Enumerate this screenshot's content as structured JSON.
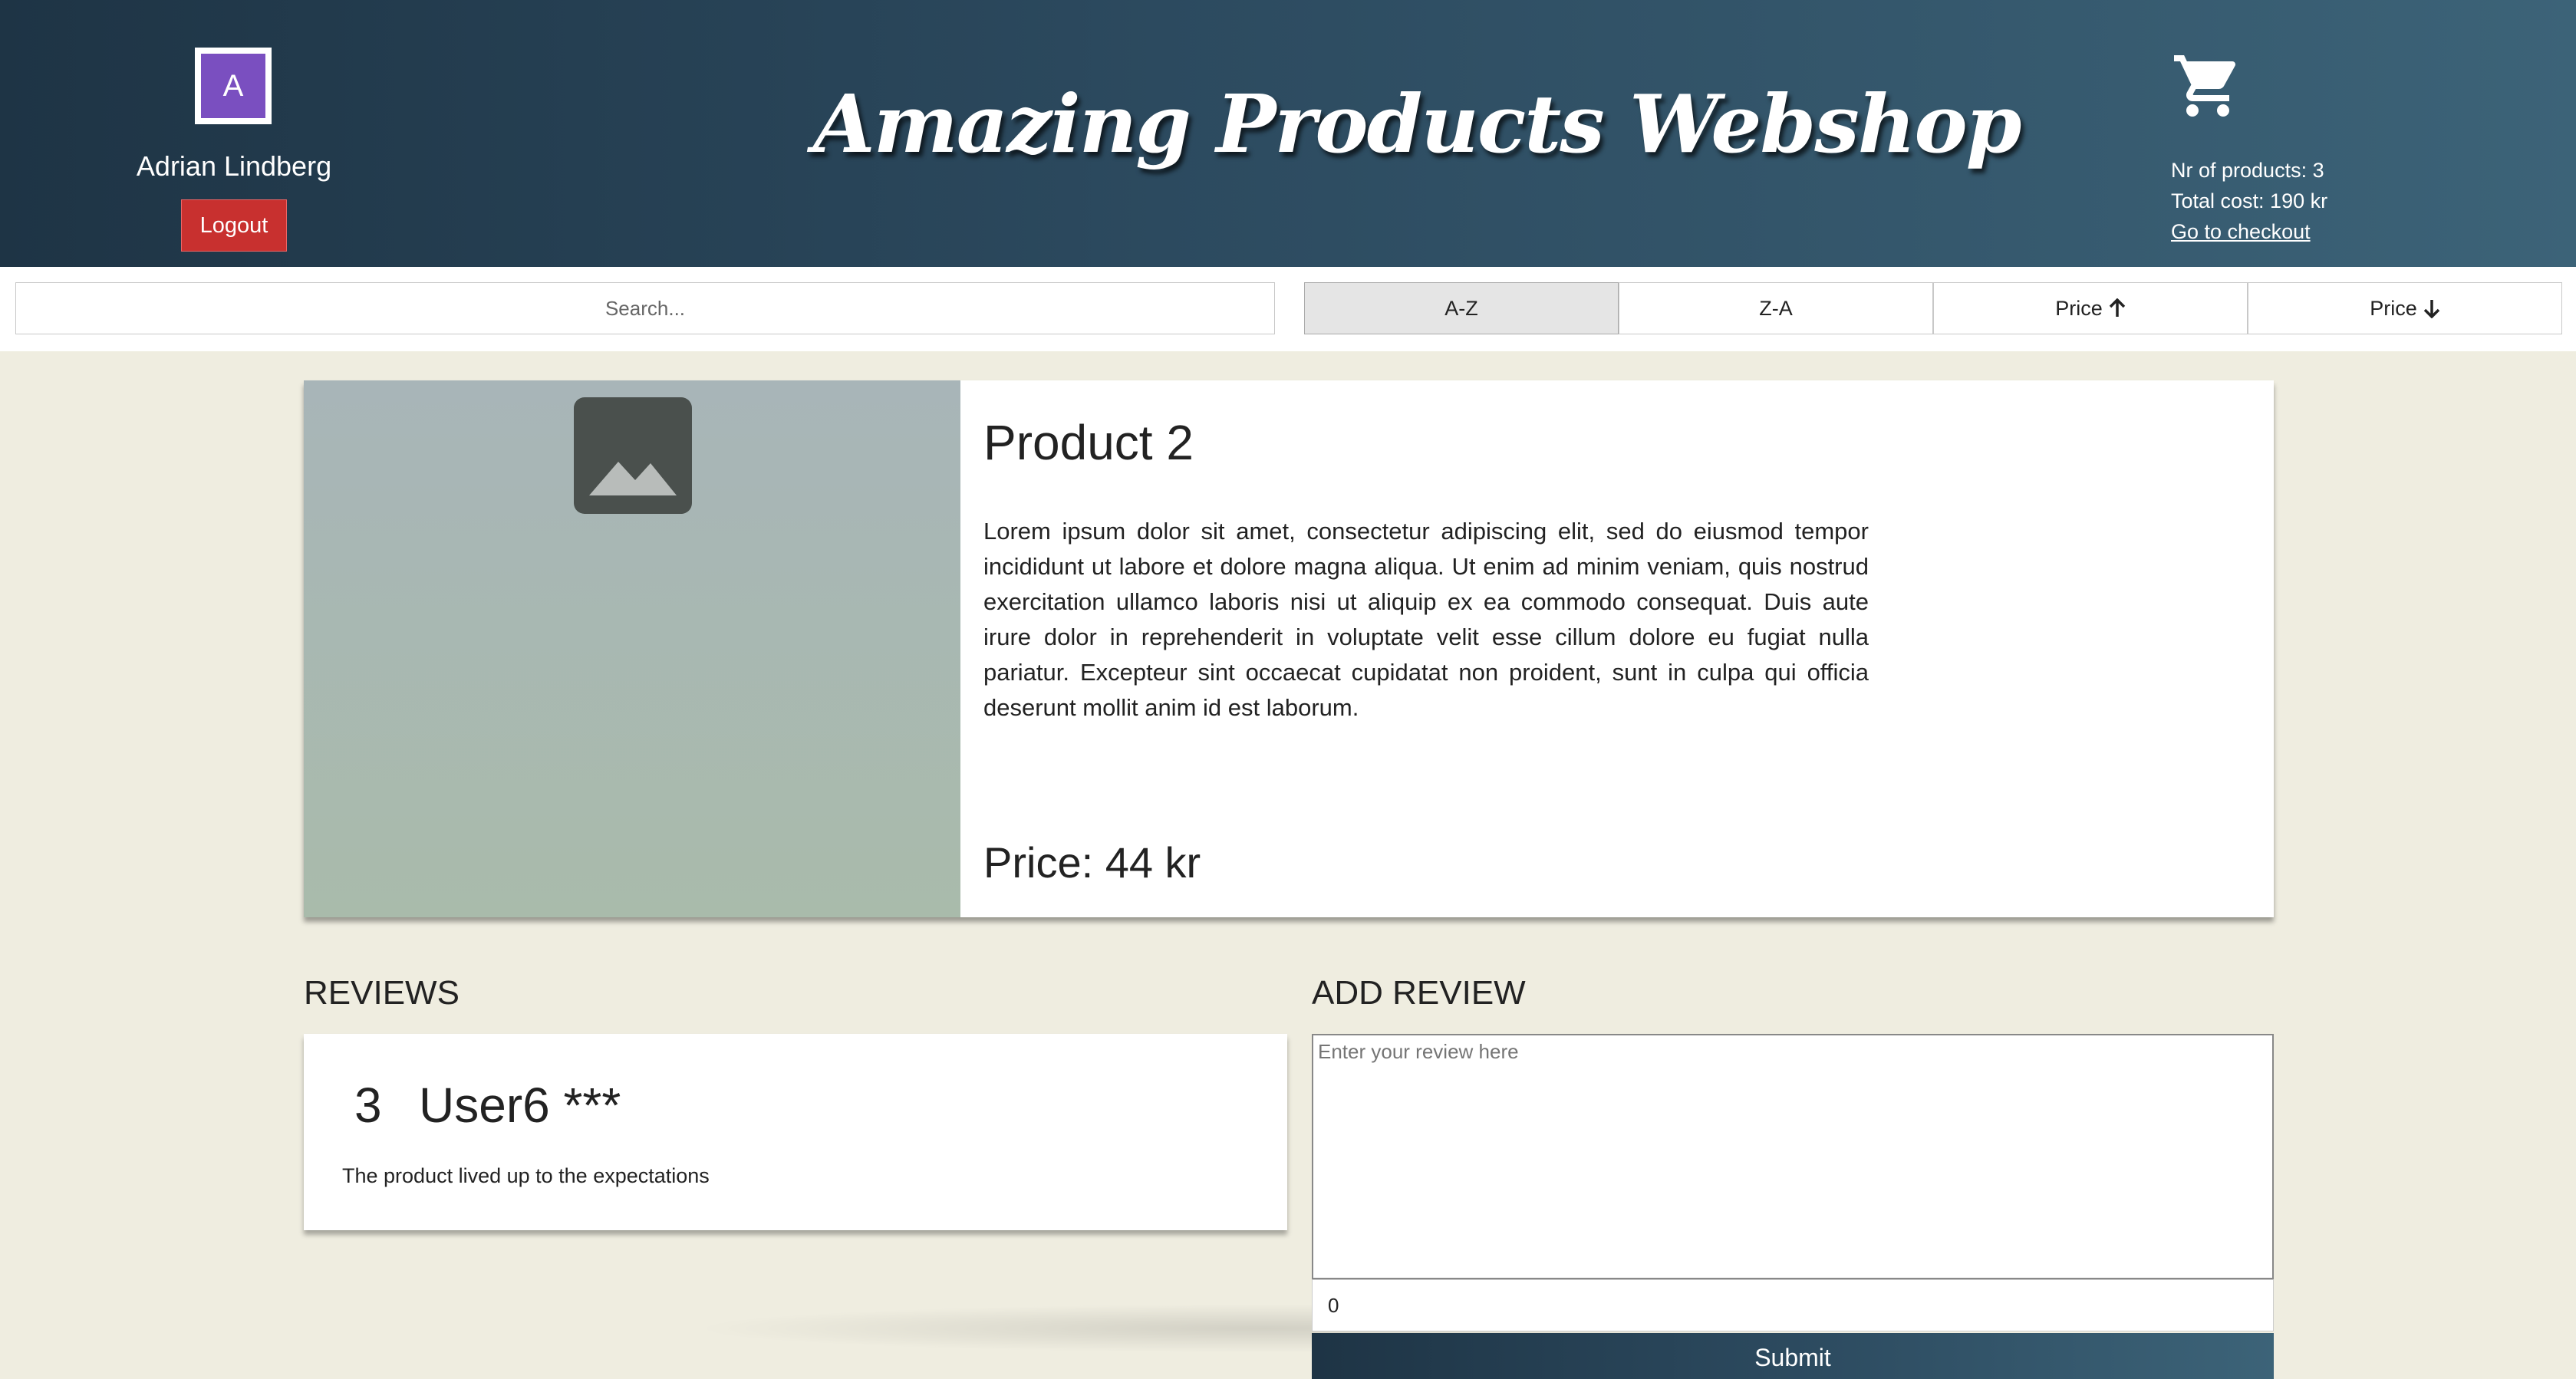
{
  "header": {
    "avatar_letter": "A",
    "username": "Adrian Lindberg",
    "logout_label": "Logout",
    "site_title": "Amazing Products Webshop",
    "cart": {
      "icon": "shopping-cart-icon",
      "nr_products_text": "Nr of products: 3",
      "total_cost_text": "Total cost: 190 kr",
      "checkout_link": "Go to checkout"
    }
  },
  "toolbar": {
    "search_placeholder": "Search...",
    "sort_buttons": [
      {
        "label": "A-Z",
        "active": true
      },
      {
        "label": "Z-A",
        "active": false
      },
      {
        "label": "Price",
        "icon": "arrow-up-icon",
        "active": false
      },
      {
        "label": "Price",
        "icon": "arrow-down-icon",
        "active": false
      }
    ]
  },
  "product": {
    "title": "Product 2",
    "image_icon": "image-placeholder-icon",
    "description": "Lorem ipsum dolor sit amet, consectetur adipiscing elit, sed do eiusmod tempor incididunt ut labore et dolore magna aliqua. Ut enim ad minim veniam, quis nostrud exercitation ullamco laboris nisi ut aliquip ex ea commodo consequat. Duis aute irure dolor in reprehenderit in voluptate velit esse cillum dolore eu fugiat nulla pariatur. Excepteur sint occaecat cupidatat non proident, sunt in culpa qui officia deserunt mollit anim id est laborum.",
    "price_text": "Price: 44 kr"
  },
  "reviews": {
    "heading": "REVIEWS",
    "items": [
      {
        "rating": "3",
        "user": "User6 ***",
        "text": "The product lived up to the expectations"
      }
    ]
  },
  "add_review": {
    "heading": "ADD REVIEW",
    "textarea_placeholder": "Enter your review here",
    "rating_value": "0",
    "submit_label": "Submit"
  },
  "colors": {
    "header_dark": "#1e3445",
    "header_light": "#3c6378",
    "logout_red": "#c8302f",
    "avatar_purple": "#7a4fc0",
    "page_background": "#efede0"
  }
}
